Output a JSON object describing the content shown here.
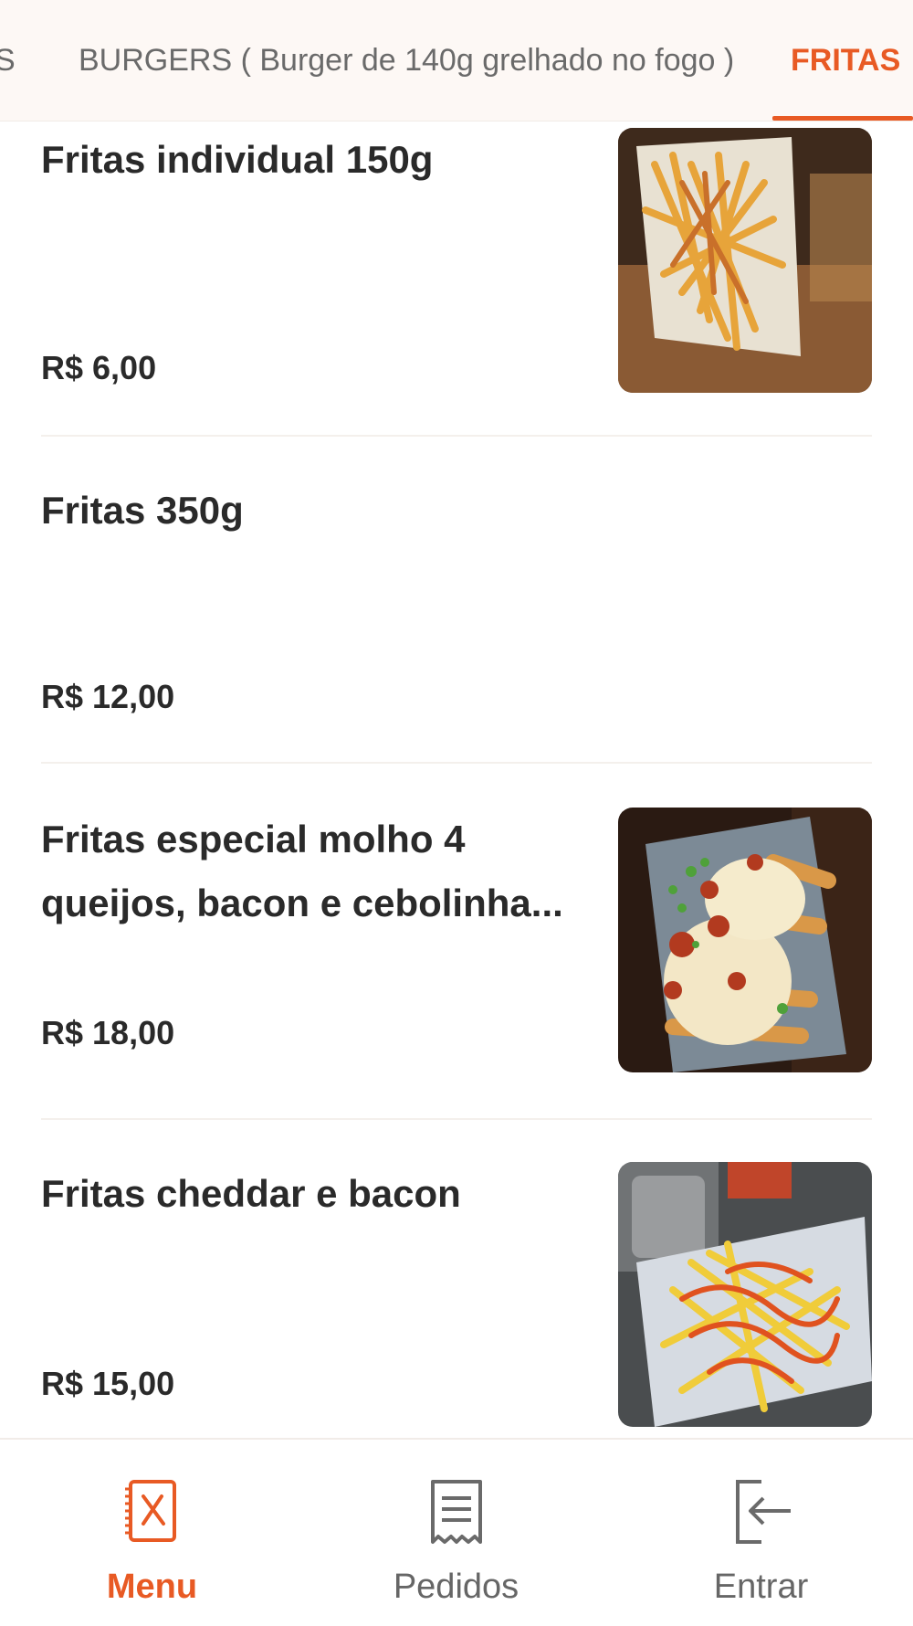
{
  "colors": {
    "accent": "#e85a24",
    "tabbar_bg": "#fdf8f5",
    "text": "#2a2a2a",
    "muted": "#666666"
  },
  "tabs": [
    {
      "label": "S"
    },
    {
      "label": "BURGERS ( Burger de 140g grelhado no fogo )"
    },
    {
      "label": "FRITAS",
      "active": true
    }
  ],
  "items": [
    {
      "name": "Fritas individual 150g",
      "price": "R$ 6,00",
      "image": "fries-on-wooden-board"
    },
    {
      "name": "Fritas 350g",
      "price": "R$ 12,00",
      "image": ""
    },
    {
      "name": "Fritas especial molho 4 queijos, bacon e cebolinha...",
      "price": "R$ 18,00",
      "image": "fries-with-cheese-sauce-bacon"
    },
    {
      "name": "Fritas cheddar e bacon",
      "price": "R$ 15,00",
      "image": "fries-with-cheddar-bacon"
    }
  ],
  "bottom_nav": [
    {
      "label": "Menu",
      "icon": "menu-book-icon",
      "active": true
    },
    {
      "label": "Pedidos",
      "icon": "receipt-icon"
    },
    {
      "label": "Entrar",
      "icon": "login-icon"
    }
  ]
}
